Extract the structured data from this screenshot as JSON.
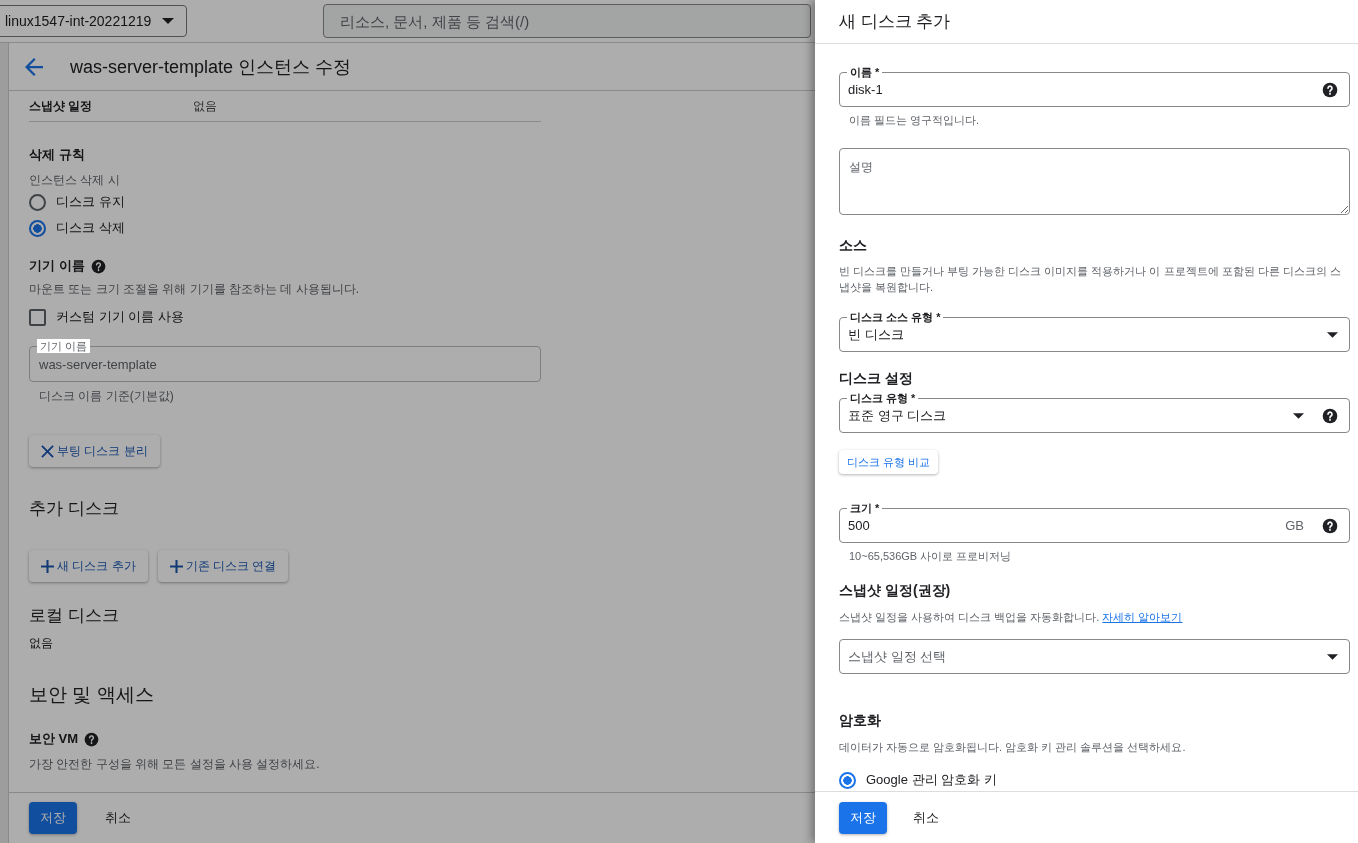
{
  "project_selector": {
    "value": "linux1547-int-20221219"
  },
  "search": {
    "placeholder": "리소스, 문서, 제품 등 검색(/)"
  },
  "page": {
    "title": "was-server-template 인스턴스 수정",
    "snapshot_row": {
      "label": "스냅샷 일정",
      "value": "없음"
    },
    "deletion_rule": {
      "title": "삭제 규칙",
      "subtitle": "인스턴스 삭제 시",
      "options": [
        {
          "label": "디스크 유지",
          "selected": false
        },
        {
          "label": "디스크 삭제",
          "selected": true
        }
      ]
    },
    "device_name": {
      "title": "기기 이름",
      "description": "마운트 또는 크기 조절을 위해 기기를 참조하는 데 사용됩니다.",
      "checkbox": {
        "label": "커스텀 기기 이름 사용",
        "checked": false
      },
      "field": {
        "label": "기기 이름",
        "value": "was-server-template",
        "disabled": true
      },
      "hint": "디스크 이름 기준(기본값)"
    },
    "detach_button": "부팅 디스크 분리",
    "additional_disks": {
      "title": "추가 디스크",
      "buttons": [
        "새 디스크 추가",
        "기존 디스크 연결"
      ]
    },
    "local_disks": {
      "title": "로컬 디스크",
      "value": "없음"
    },
    "security": {
      "title": "보안 및 액세스",
      "shielded_vm": {
        "title": "보안 VM",
        "description": "가장 안전한 구성을 위해 모든 설정을 사용 설정하세요."
      }
    },
    "footer": {
      "save": "저장",
      "cancel": "취소"
    }
  },
  "panel": {
    "title": "새 디스크 추가",
    "name_field": {
      "label": "이름 *",
      "value": "disk-1",
      "hint": "이름 필드는 영구적입니다."
    },
    "description_field": {
      "placeholder": "설명"
    },
    "source": {
      "title": "소스",
      "description": "빈 디스크를 만들거나 부팅 가능한 디스크 이미지를 적용하거나 이 프로젝트에 포함된 다른 디스크의 스냅샷을 복원합니다.",
      "select": {
        "label": "디스크 소스 유형 *",
        "value": "빈 디스크"
      }
    },
    "disk_settings": {
      "title": "디스크 설정",
      "select": {
        "label": "디스크 유형 *",
        "value": "표준 영구 디스크"
      },
      "compare_button": "디스크 유형 비교",
      "size_field": {
        "label": "크기 *",
        "value": "500",
        "suffix": "GB",
        "hint": "10~65,536GB 사이로 프로비저닝"
      }
    },
    "snapshot": {
      "title": "스냅샷 일정(권장)",
      "description": "스냅샷 일정을 사용하여 디스크 백업을 자동화합니다.",
      "link": "자세히 알아보기",
      "select": {
        "placeholder": "스냅샷 일정 선택"
      }
    },
    "encryption": {
      "title": "암호화",
      "description": "데이터가 자동으로 암호화됩니다. 암호화 키 관리 솔루션을 선택하세요.",
      "options": [
        {
          "label": "Google 관리 암호화 키",
          "selected": true
        }
      ]
    },
    "footer": {
      "save": "저장",
      "cancel": "취소"
    }
  }
}
